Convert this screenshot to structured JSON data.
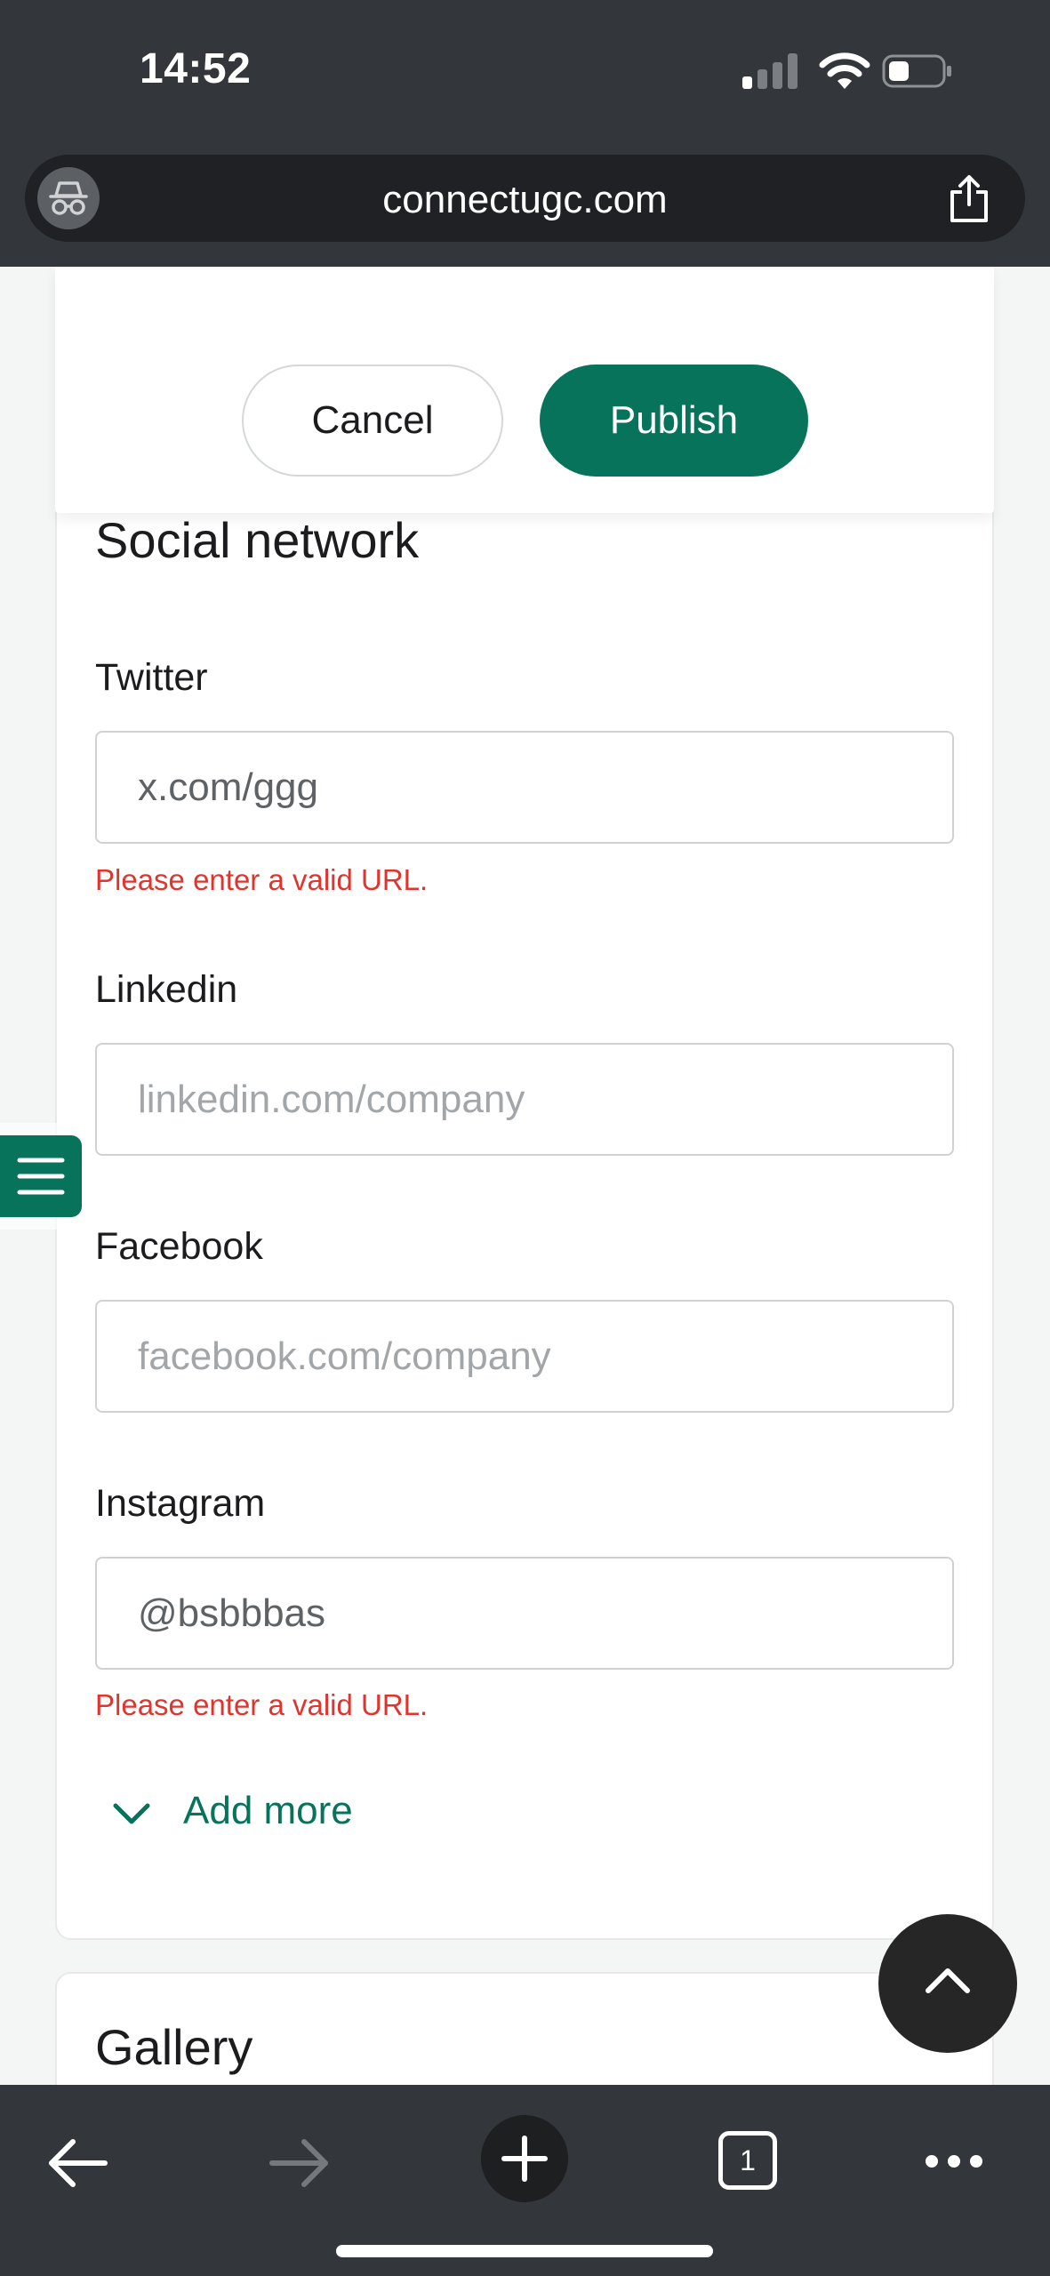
{
  "status_bar": {
    "time": "14:52"
  },
  "browser": {
    "url": "connectugc.com",
    "tab_count": "1"
  },
  "actions": {
    "cancel_label": "Cancel",
    "publish_label": "Publish"
  },
  "social": {
    "title": "Social network",
    "fields": [
      {
        "label": "Twitter",
        "value": "x.com/ggg",
        "placeholder": "",
        "error": "Please enter a valid URL."
      },
      {
        "label": "Linkedin",
        "value": "",
        "placeholder": "linkedin.com/company",
        "error": ""
      },
      {
        "label": "Facebook",
        "value": "",
        "placeholder": "facebook.com/company",
        "error": ""
      },
      {
        "label": "Instagram",
        "value": "@bsbbbas",
        "placeholder": "",
        "error": "Please enter a valid URL."
      }
    ],
    "add_more_label": "Add more"
  },
  "gallery": {
    "title": "Gallery"
  },
  "colors": {
    "brand_green": "#07735a",
    "error_red": "#e0352f",
    "chrome_dark": "#33373b"
  },
  "icons": {
    "incognito": "incognito-icon",
    "share": "share-icon",
    "menu": "hamburger-menu-icon",
    "add_more": "chevron-down-icon",
    "scroll_top": "chevron-up-icon",
    "back": "back-arrow-icon",
    "forward": "forward-arrow-icon",
    "new_tab": "plus-icon",
    "more": "more-dots-icon"
  }
}
